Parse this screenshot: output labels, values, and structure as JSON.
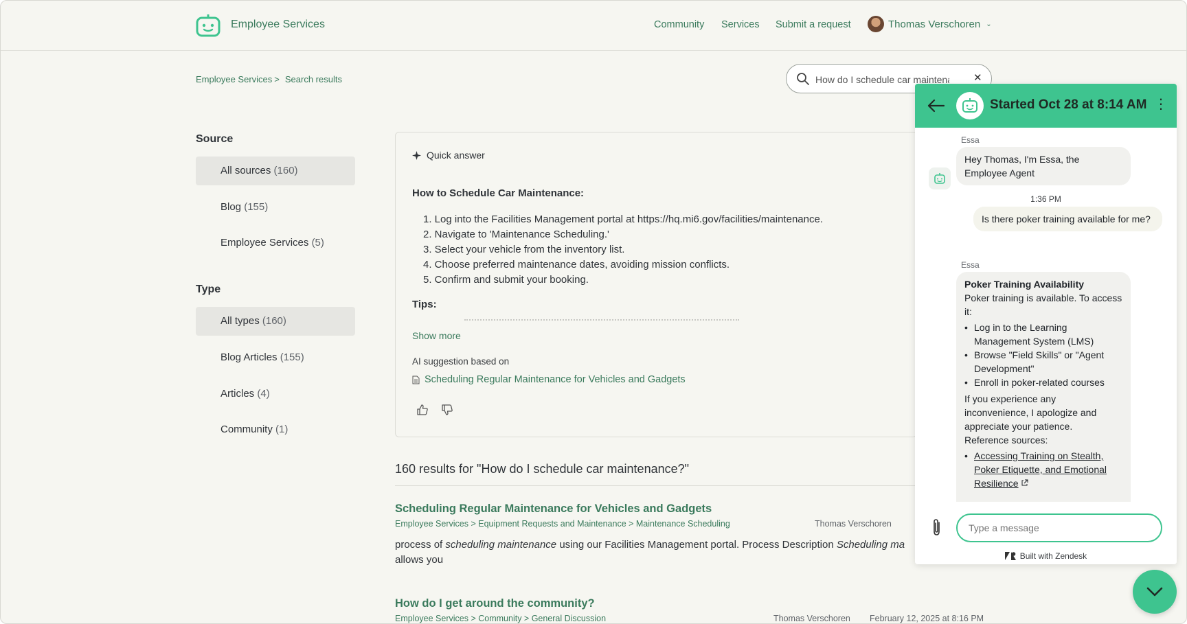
{
  "header": {
    "brand": "Employee Services",
    "nav": [
      "Community",
      "Services",
      "Submit a request"
    ],
    "user_name": "Thomas Verschoren"
  },
  "breadcrumb": {
    "home": "Employee Services",
    "sep": ">",
    "current": "Search results"
  },
  "search": {
    "value": "How do I schedule car maintenance?",
    "clear": "✕"
  },
  "filters": {
    "source_title": "Source",
    "sources": [
      {
        "label": "All sources",
        "count": "(160)"
      },
      {
        "label": "Blog",
        "count": "(155)"
      },
      {
        "label": "Employee Services",
        "count": "(5)"
      }
    ],
    "type_title": "Type",
    "types": [
      {
        "label": "All types",
        "count": "(160)"
      },
      {
        "label": "Blog Articles",
        "count": "(155)"
      },
      {
        "label": "Articles",
        "count": "(4)"
      },
      {
        "label": "Community",
        "count": "(1)"
      }
    ]
  },
  "quick_answer": {
    "label": "Quick answer",
    "title": "How to Schedule Car Maintenance:",
    "steps": [
      "1. Log into the Facilities Management portal at https://hq.mi6.gov/facilities/maintenance.",
      "2. Navigate to 'Maintenance Scheduling.'",
      "3. Select your vehicle from the inventory list.",
      "4. Choose preferred maintenance dates, avoiding mission conflicts.",
      "5. Confirm and submit your booking."
    ],
    "tips": "Tips:",
    "show_more": "Show more",
    "based_on": "AI suggestion based on",
    "source": "Scheduling Regular Maintenance for Vehicles and Gadgets"
  },
  "results": {
    "heading": "160 results for \"How do I schedule car maintenance?\"",
    "items": [
      {
        "title": "Scheduling Regular Maintenance for Vehicles and Gadgets",
        "path": "Employee Services > Equipment Requests and Maintenance > Maintenance Scheduling",
        "author": "Thomas Verschoren",
        "snippet_a": "process of ",
        "snippet_em1": "scheduling maintenance",
        "snippet_b": " using our Facilities Management portal. Process Description ",
        "snippet_em2": "Scheduling ma",
        "snippet_c": "allows you"
      },
      {
        "title": "How do I get around the community?",
        "path": "Employee Services > Community > General Discussion",
        "author": "Thomas Verschoren",
        "date": "February 12, 2025 at 8:16 PM"
      }
    ]
  },
  "chat": {
    "title": "Started Oct 28 at 8:14 AM",
    "menu": "⋮",
    "sender": "Essa",
    "greeting": "Hey Thomas, I'm Essa, the Employee Agent",
    "time": "1:36 PM",
    "user_msg": "Is there poker training available for me?",
    "reply_title": "Poker Training Availability",
    "reply_intro": "Poker training is available. To access it:",
    "reply_bullets": [
      "Log in to the Learning Management System (LMS)",
      "Browse \"Field Skills\" or \"Agent Development\"",
      "Enroll in poker-related courses"
    ],
    "reply_apology": "If you experience any inconvenience, I apologize and appreciate your patience.",
    "reply_ref_label": "Reference sources:",
    "reply_ref_link": "Accessing Training on Stealth, Poker Etiquette, and Emotional Resilience",
    "input_placeholder": "Type a message",
    "built_with": "Built with Zendesk"
  },
  "colors": {
    "accent": "#3ec48f",
    "link": "#3a7a5c",
    "background": "#f6f6f1"
  }
}
